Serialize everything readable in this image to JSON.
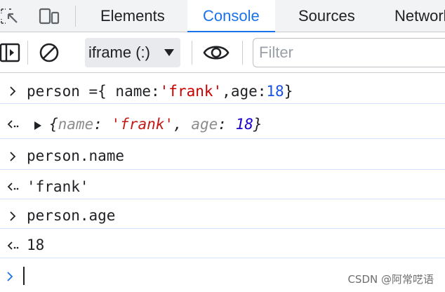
{
  "tabs": [
    {
      "label": "Elements",
      "active": false
    },
    {
      "label": "Console",
      "active": true
    },
    {
      "label": "Sources",
      "active": false
    },
    {
      "label": "Network",
      "active": false
    }
  ],
  "toolbar": {
    "context": "iframe (:)",
    "filter_placeholder": "Filter"
  },
  "console": {
    "entries": [
      {
        "kind": "input",
        "parts": [
          {
            "text": "person ={ name:",
            "style": "plain"
          },
          {
            "text": "'frank'",
            "style": "string"
          },
          {
            "text": ",age:",
            "style": "plain"
          },
          {
            "text": "18",
            "style": "number"
          },
          {
            "text": "}",
            "style": "plain"
          }
        ]
      },
      {
        "kind": "result-object",
        "parts": [
          {
            "text": "{",
            "style": "plain"
          },
          {
            "text": "name",
            "style": "key"
          },
          {
            "text": ": ",
            "style": "plain"
          },
          {
            "text": "'frank'",
            "style": "string"
          },
          {
            "text": ", ",
            "style": "plain"
          },
          {
            "text": "age",
            "style": "key"
          },
          {
            "text": ": ",
            "style": "plain"
          },
          {
            "text": "18",
            "style": "number"
          },
          {
            "text": "}",
            "style": "plain"
          }
        ]
      },
      {
        "kind": "input",
        "text": "person.name"
      },
      {
        "kind": "result",
        "text": "'frank'",
        "style": "string"
      },
      {
        "kind": "input",
        "text": "person.age"
      },
      {
        "kind": "result",
        "text": "18",
        "style": "number"
      }
    ]
  },
  "watermark": "CSDN @阿常呓语",
  "colors": {
    "accent": "#1a73e8",
    "string": "#c80000",
    "number": "#1a1aa6",
    "divider": "#d3e3fd"
  },
  "icons": [
    "inspect-element-icon",
    "device-toolbar-icon",
    "show-sidebar-icon",
    "clear-console-icon",
    "live-expression-eye-icon",
    "chevron-right-icon",
    "result-arrow-icon",
    "expand-triangle-icon",
    "dropdown-arrow-icon"
  ]
}
